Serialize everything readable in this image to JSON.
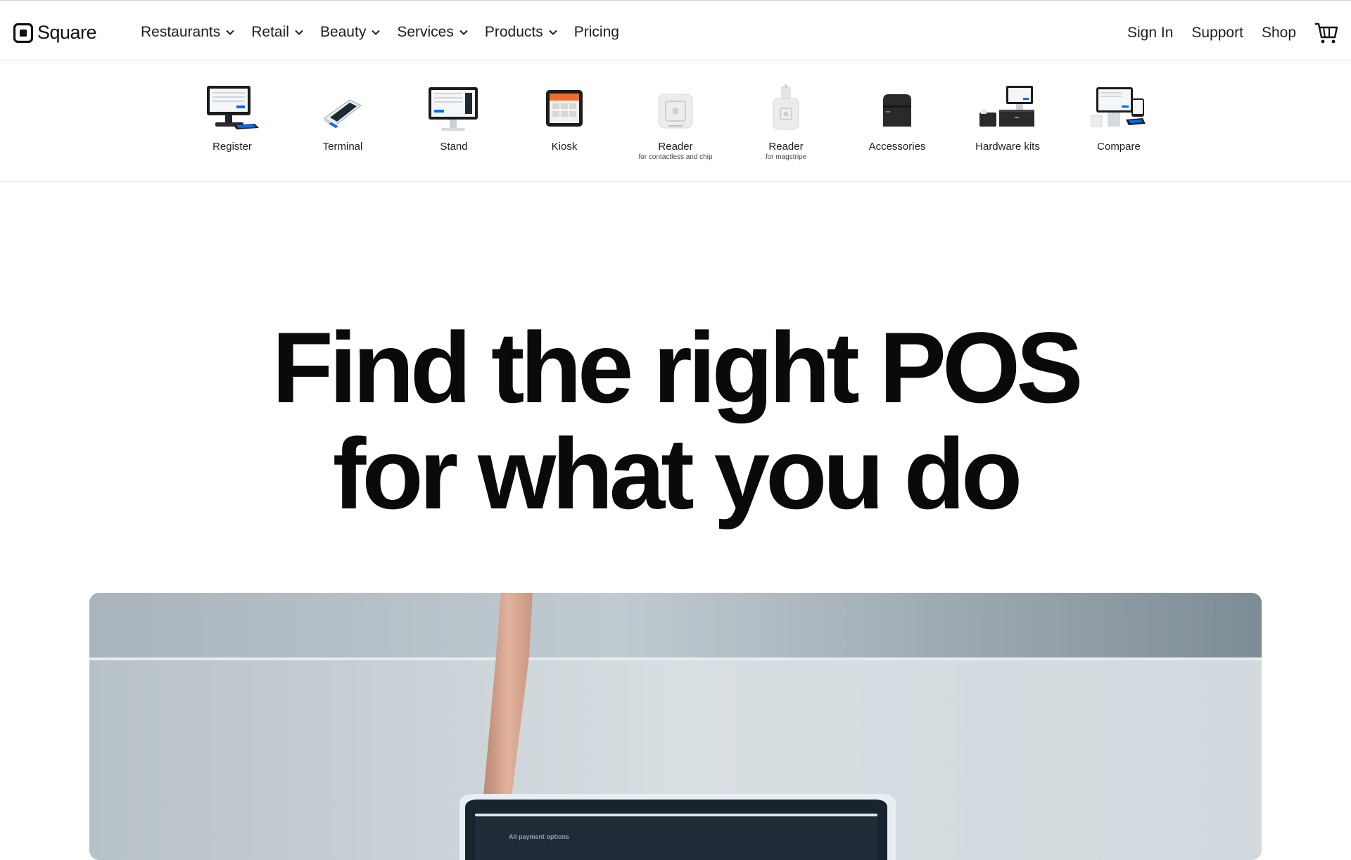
{
  "brand": {
    "name": "Square"
  },
  "nav": {
    "items": [
      {
        "label": "Restaurants",
        "dropdown": true
      },
      {
        "label": "Retail",
        "dropdown": true
      },
      {
        "label": "Beauty",
        "dropdown": true
      },
      {
        "label": "Services",
        "dropdown": true
      },
      {
        "label": "Products",
        "dropdown": true
      },
      {
        "label": "Pricing",
        "dropdown": false
      }
    ],
    "right": {
      "sign_in": "Sign In",
      "support": "Support",
      "shop": "Shop",
      "cart_icon": "cart-icon"
    }
  },
  "products": [
    {
      "label": "Register",
      "sub": ""
    },
    {
      "label": "Terminal",
      "sub": ""
    },
    {
      "label": "Stand",
      "sub": ""
    },
    {
      "label": "Kiosk",
      "sub": ""
    },
    {
      "label": "Reader",
      "sub": "for contactless and chip"
    },
    {
      "label": "Reader",
      "sub": "for magstripe"
    },
    {
      "label": "Accessories",
      "sub": ""
    },
    {
      "label": "Hardware kits",
      "sub": ""
    },
    {
      "label": "Compare",
      "sub": ""
    }
  ],
  "hero": {
    "line1": "Find the right POS",
    "line2": "for what you do",
    "screen_text": "All payment options"
  },
  "colors": {
    "accent": "#006aff",
    "text": "#0a0a0a",
    "border": "#e2e2e2"
  }
}
